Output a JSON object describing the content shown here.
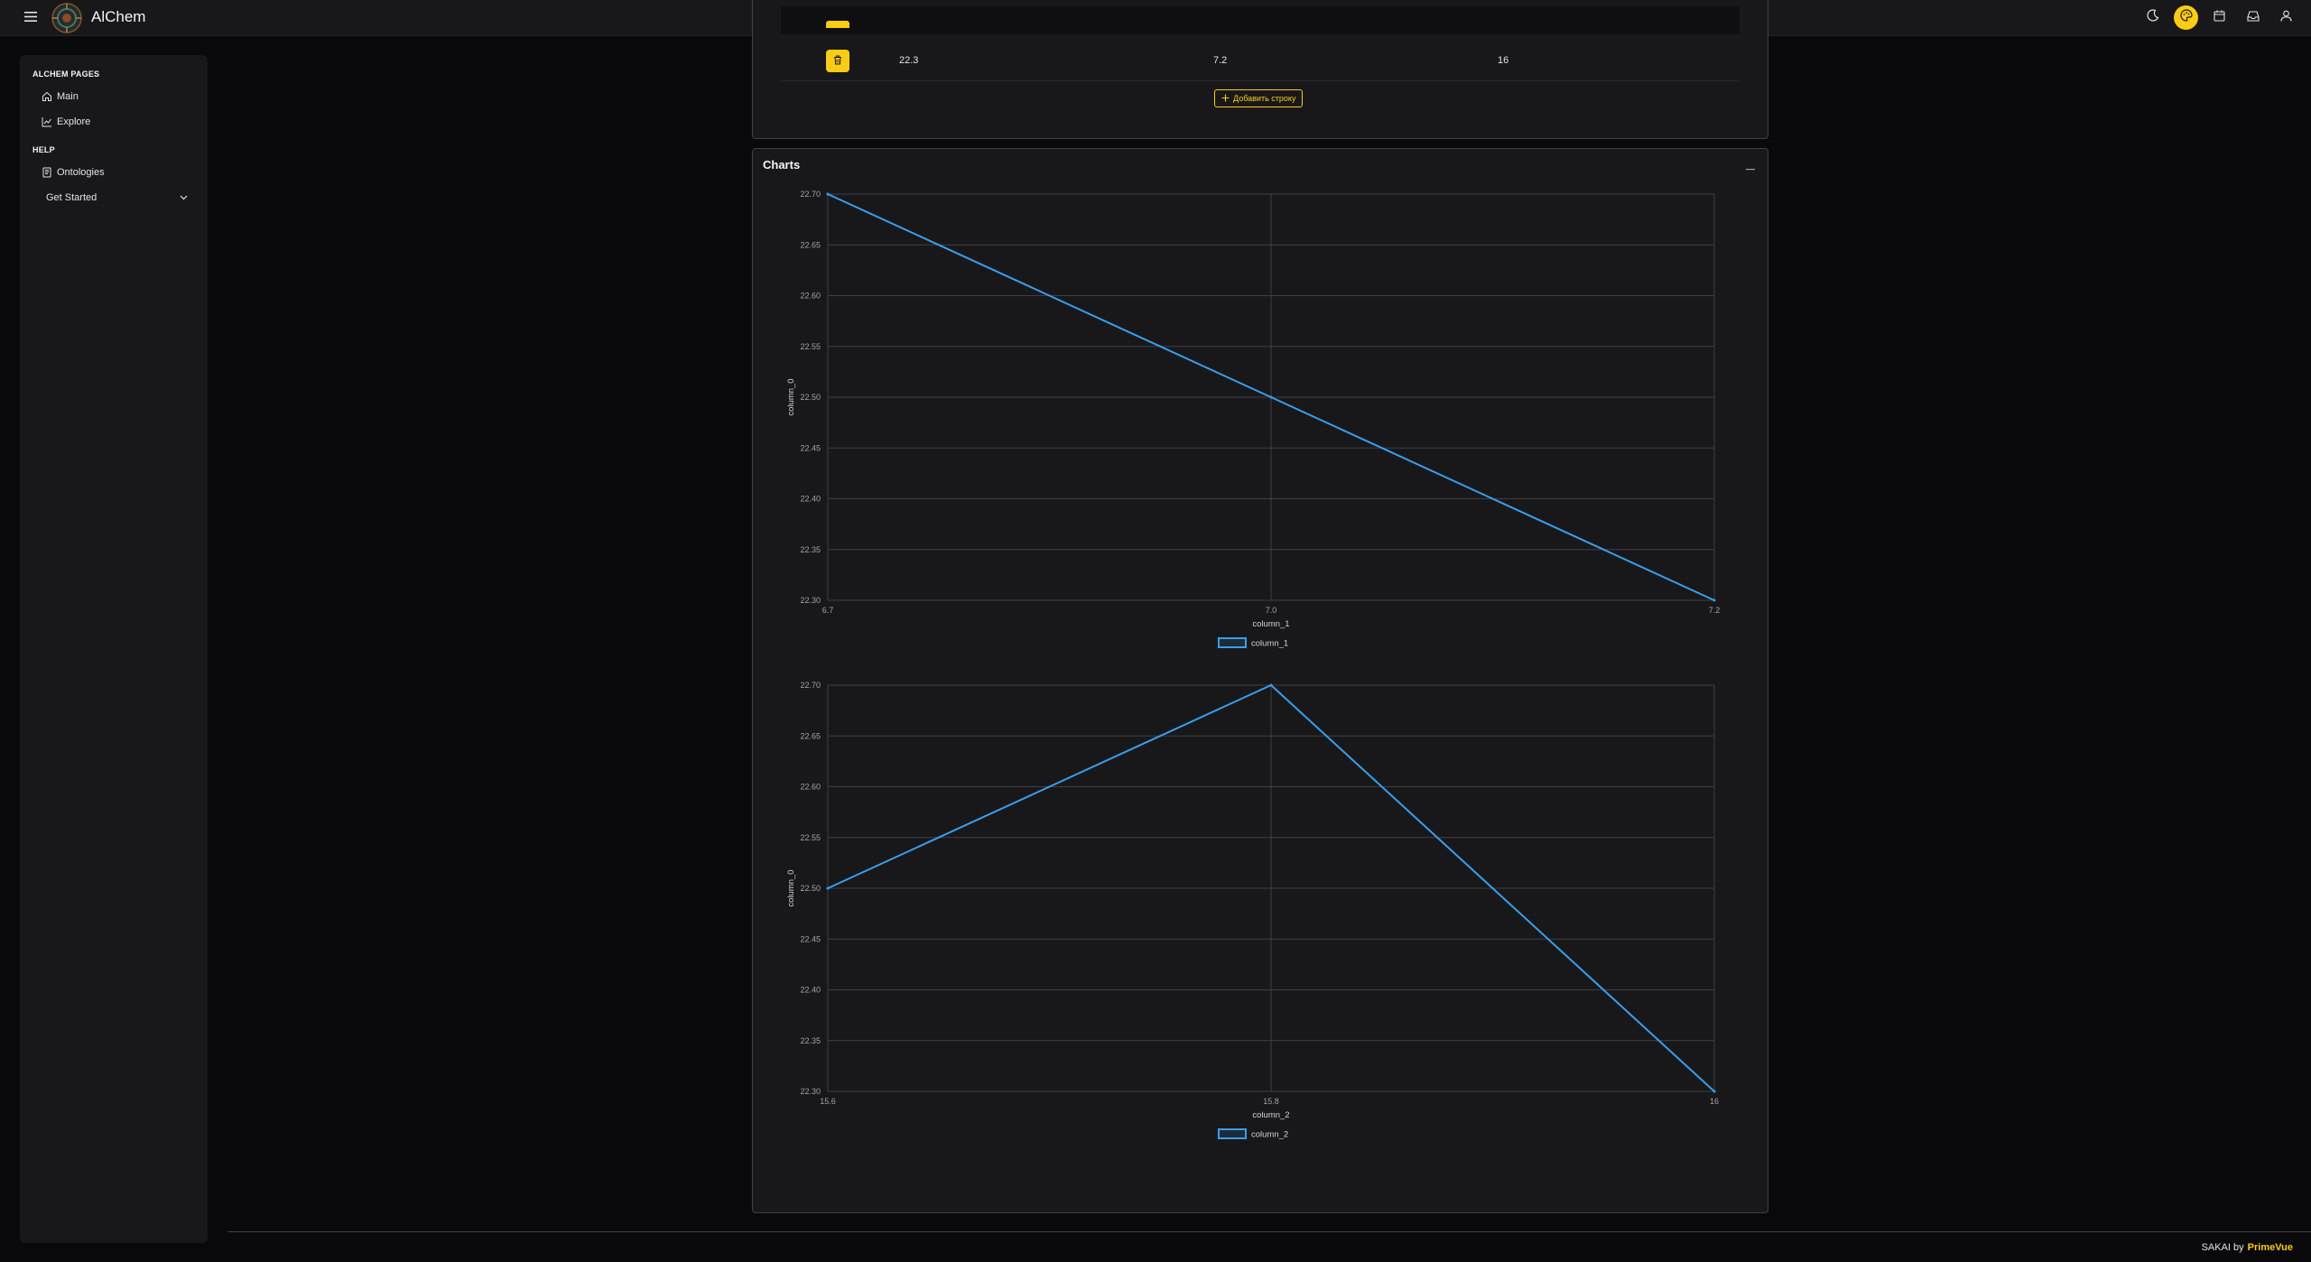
{
  "app": {
    "title": "AlChem"
  },
  "topbar": {
    "icons": [
      "moon-icon",
      "palette-icon",
      "calendar-icon",
      "inbox-icon",
      "user-icon"
    ]
  },
  "sidebar": {
    "section1": "ALCHEM PAGES",
    "main_label": "Main",
    "explore_label": "Explore",
    "section2": "HELP",
    "ontologies_label": "Ontologies",
    "get_started_label": "Get Started"
  },
  "table": {
    "row": {
      "col0": "22.3",
      "col1": "7.2",
      "col2": "16"
    },
    "add_row_label": "Добавить строку"
  },
  "charts": {
    "title": "Charts"
  },
  "chart_data": [
    {
      "type": "line",
      "x": [
        6.7,
        7.0,
        7.2
      ],
      "x_tick_labels": [
        "6.7",
        "7.0",
        "7.2"
      ],
      "series": [
        {
          "name": "column_1",
          "values": [
            22.7,
            22.5,
            22.3
          ],
          "color": "#3b9eea"
        }
      ],
      "xlabel": "column_1",
      "ylabel": "column_0",
      "ylim": [
        22.3,
        22.7
      ],
      "y_ticks": [
        "22.30",
        "22.35",
        "22.40",
        "22.45",
        "22.50",
        "22.55",
        "22.60",
        "22.65",
        "22.70"
      ],
      "x_axis": "category",
      "grid": true,
      "legend": "bottom-center"
    },
    {
      "type": "line",
      "x": [
        15.6,
        15.8,
        16
      ],
      "x_tick_labels": [
        "15.6",
        "15.8",
        "16"
      ],
      "series": [
        {
          "name": "column_2",
          "values": [
            22.5,
            22.7,
            22.3
          ],
          "color": "#3b9eea"
        }
      ],
      "xlabel": "column_2",
      "ylabel": "column_0",
      "ylim": [
        22.3,
        22.7
      ],
      "y_ticks": [
        "22.30",
        "22.35",
        "22.40",
        "22.45",
        "22.50",
        "22.55",
        "22.60",
        "22.65",
        "22.70"
      ],
      "x_axis": "category",
      "grid": true,
      "legend": "bottom-center"
    }
  ],
  "footer": {
    "text": "SAKAI by",
    "brand": "PrimeVue"
  },
  "colors": {
    "accent": "#facc15",
    "line": "#3b9eea",
    "panel": "#18181b",
    "background": "#09090b"
  }
}
